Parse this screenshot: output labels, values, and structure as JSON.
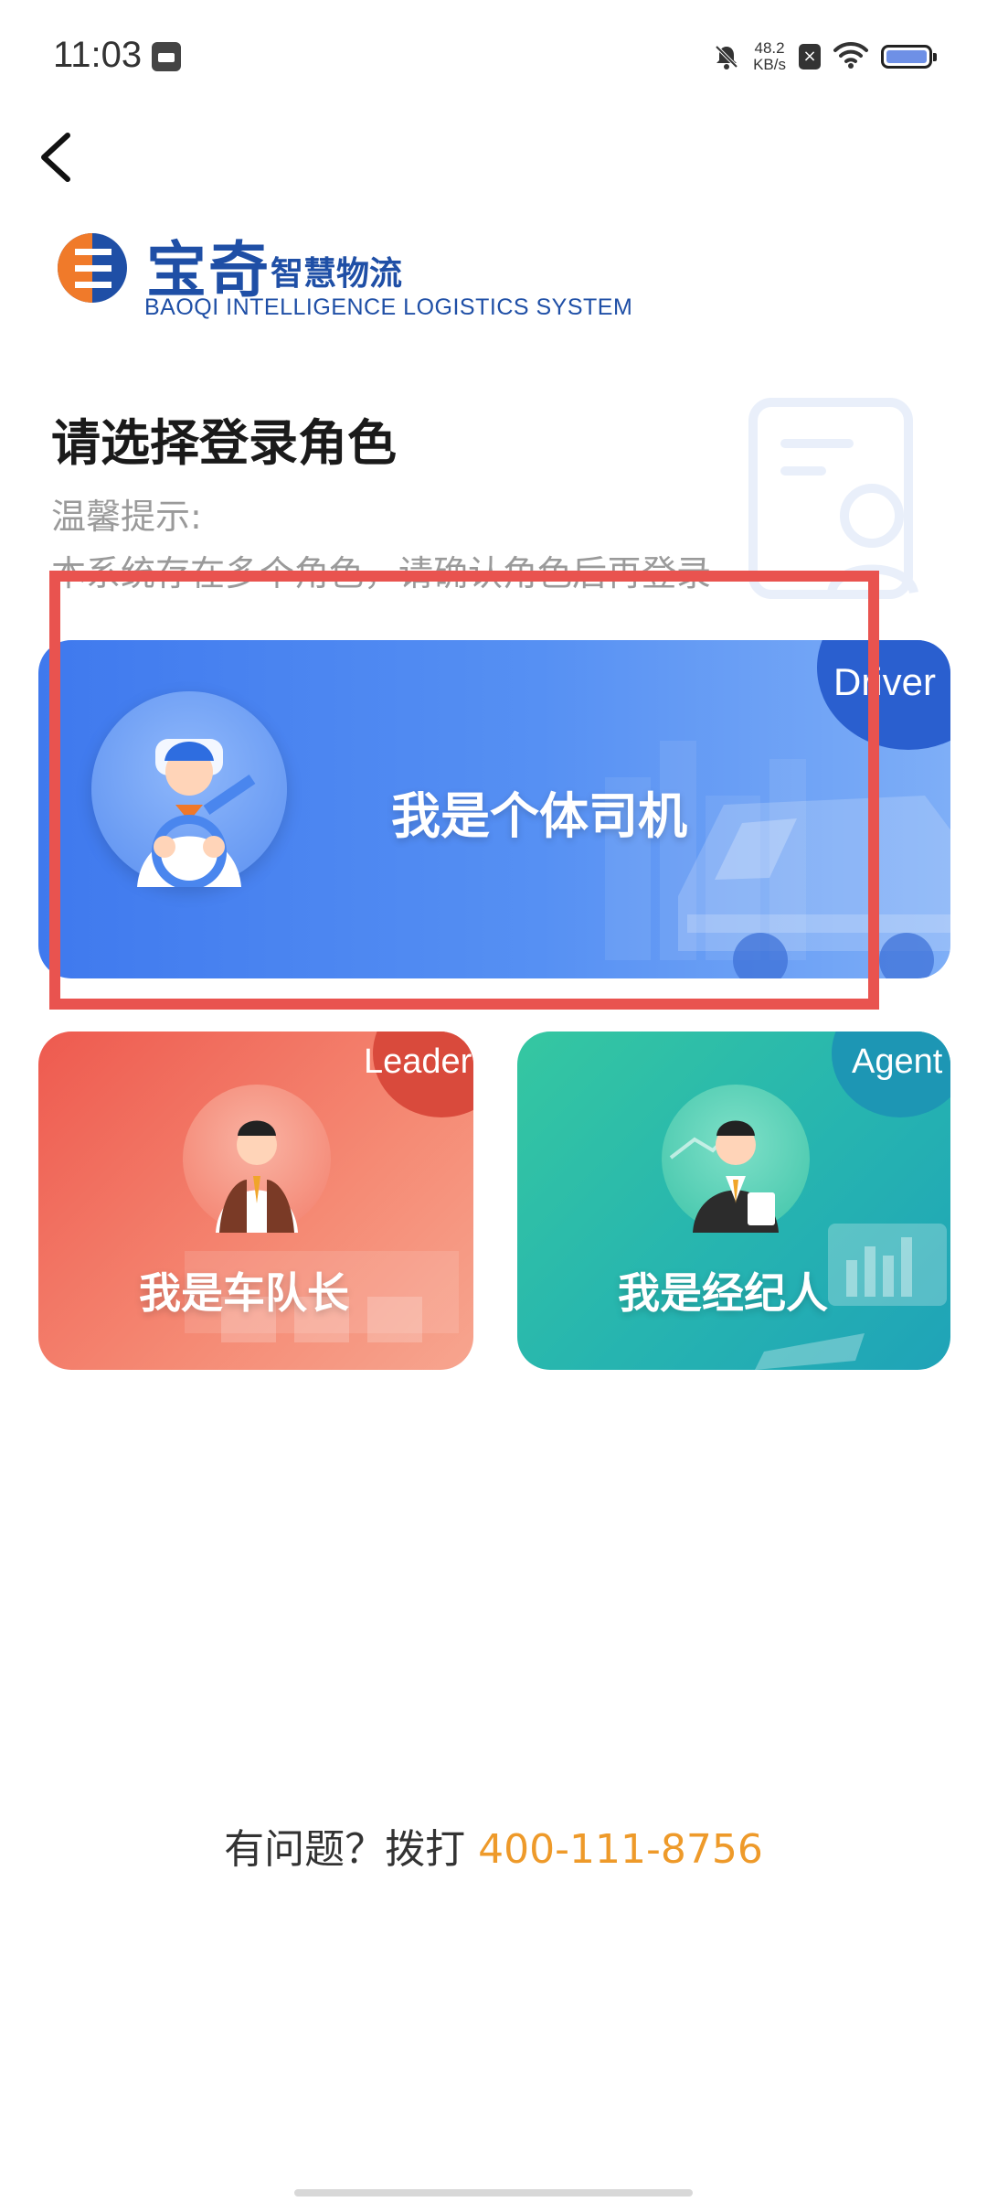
{
  "status_bar": {
    "time": "11:03",
    "net_speed_value": "48.2",
    "net_speed_unit": "KB/s",
    "icons": [
      "calendar-icon",
      "mute-icon",
      "close-box-icon",
      "wifi-icon",
      "battery-icon"
    ]
  },
  "header": {
    "back_icon": "chevron-left-icon"
  },
  "logo": {
    "cn_main": "宝奇",
    "cn_sub": "智慧物流",
    "en": "BAOQI INTELLIGENCE LOGISTICS SYSTEM"
  },
  "page": {
    "title": "请选择登录角色",
    "tip_label": "温馨提示:",
    "tip_text": "本系统存在多个角色，请确认角色后再登录"
  },
  "roles": {
    "driver": {
      "badge": "Driver",
      "label": "我是个体司机"
    },
    "leader": {
      "badge": "Leader",
      "label": "我是车队长"
    },
    "agent": {
      "badge": "Agent",
      "label": "我是经纪人"
    }
  },
  "help": {
    "prefix": "有问题？拨打 ",
    "phone": "400-111-8756"
  },
  "colors": {
    "brand": "#1f4fa6",
    "driver_card": "#4a85f0",
    "leader_card": "#ee5a4f",
    "agent_card": "#2bbcab",
    "phone": "#ee9a2a",
    "highlight": "#e9534f"
  }
}
